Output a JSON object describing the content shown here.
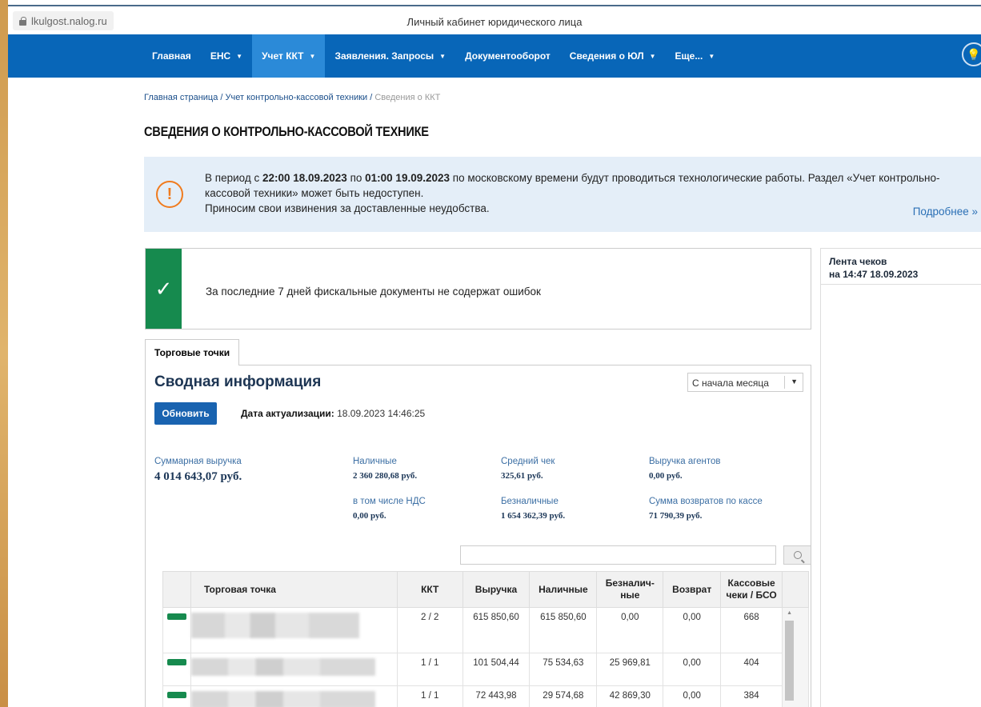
{
  "browser": {
    "url": "lkulgost.nalog.ru",
    "title": "Личный кабинет юридического лица"
  },
  "nav": {
    "items": [
      {
        "label": "Главная",
        "caret": false
      },
      {
        "label": "ЕНС",
        "caret": true
      },
      {
        "label": "Учет ККТ",
        "caret": true,
        "active": true
      },
      {
        "label": "Заявления. Запросы",
        "caret": true
      },
      {
        "label": "Документооборот",
        "caret": false
      },
      {
        "label": "Сведения о ЮЛ",
        "caret": true
      },
      {
        "label": "Еще...",
        "caret": true
      }
    ]
  },
  "breadcrumb": {
    "home": "Главная страница",
    "section": "Учет контрольно-кассовой техники",
    "current": "Сведения о ККТ"
  },
  "page_title": "СВЕДЕНИЯ О КОНТРОЛЬНО-КАССОВОЙ ТЕХНИКЕ",
  "notice": {
    "pre": "В период с ",
    "from": "22:00 18.09.2023",
    "mid": " по ",
    "to": "01:00 19.09.2023",
    "post": " по московскому времени будут проводиться технологические работы. Раздел «Учет контрольно-кассовой техники» может быть недоступен.",
    "apology": "Приносим свои извинения за доставленные неудобства.",
    "more": "Подробнее »"
  },
  "status": {
    "text": "За последние 7 дней фискальные документы не содержат ошибок",
    "icon": "✓"
  },
  "side": {
    "title": "Лента чеков",
    "subtitle": "на 14:47 18.09.2023"
  },
  "tab": "Торговые точки",
  "summary": {
    "title": "Сводная информация",
    "period": "С начала месяца",
    "refresh": "Обновить",
    "update_label": "Дата актуализации:",
    "update_value": " 18.09.2023 14:46:25",
    "total_label": "Суммарная выручка",
    "total_value": "4 014 643,07 руб.",
    "cash_label": "Наличные",
    "cash_value": "2 360 280,68 руб.",
    "vat_label": "в том числе НДС",
    "vat_value": "0,00 руб.",
    "avg_label": "Средний чек",
    "avg_value": "325,61 руб.",
    "noncash_label": "Безналичные",
    "noncash_value": "1 654 362,39 руб.",
    "agents_label": "Выручка агентов",
    "agents_value": "0,00 руб.",
    "returns_label": "Сумма возвратов по кассе",
    "returns_value": "71 790,39 руб."
  },
  "table": {
    "headers": [
      "Торговая точка",
      "ККТ",
      "Выручка",
      "Наличные",
      "Безналич-ные",
      "Возврат",
      "Кассовые чеки / БСО"
    ],
    "rows": [
      {
        "kkt": "2 / 2",
        "revenue": "615 850,60",
        "cash": "615 850,60",
        "noncash": "0,00",
        "returns": "0,00",
        "checks": "668"
      },
      {
        "kkt": "1 / 1",
        "revenue": "101 504,44",
        "cash": "75 534,63",
        "noncash": "25 969,81",
        "returns": "0,00",
        "checks": "404"
      },
      {
        "kkt": "1 / 1",
        "revenue": "72 443,98",
        "cash": "29 574,68",
        "noncash": "42 869,30",
        "returns": "0,00",
        "checks": "384"
      }
    ]
  },
  "colors": {
    "nav": "#0866b8",
    "nav_active": "#2b8ad8",
    "success": "#168a4e",
    "warning": "#f07b1e",
    "button": "#1963b0"
  }
}
